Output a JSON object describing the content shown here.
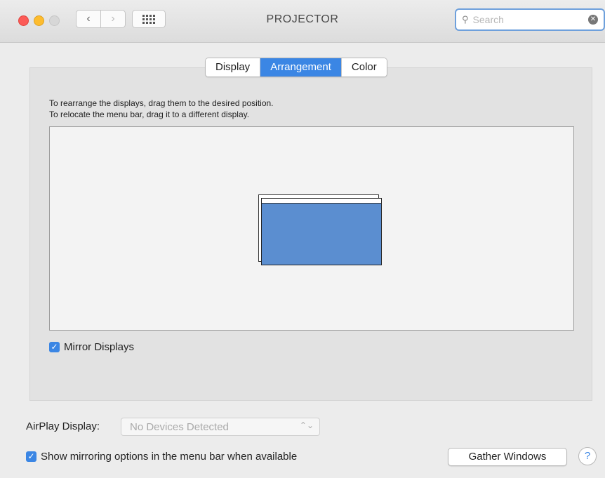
{
  "window": {
    "title": "PROJECTOR",
    "search_placeholder": "Search",
    "search_clear_glyph": "✕"
  },
  "toolbar": {
    "back_glyph": "‹",
    "forward_glyph": "›"
  },
  "tabs": [
    {
      "label": "Display",
      "active": false
    },
    {
      "label": "Arrangement",
      "active": true
    },
    {
      "label": "Color",
      "active": false
    }
  ],
  "arrangement": {
    "instruction_1": "To rearrange the displays, drag them to the desired position.",
    "instruction_2": "To relocate the menu bar, drag it to a different display.",
    "mirror_label": "Mirror Displays",
    "mirror_checked": true
  },
  "airplay": {
    "label": "AirPlay Display:",
    "value": "No Devices Detected",
    "arrows_glyph": "⌃⌄"
  },
  "show_mirroring": {
    "label": "Show mirroring options in the menu bar when available",
    "checked": true
  },
  "buttons": {
    "gather_windows": "Gather Windows",
    "help": "?"
  },
  "check_glyph": "✓",
  "colors": {
    "accent": "#3b86e4",
    "display_fill": "#5b8ed0",
    "close": "#fc5b57",
    "minimize": "#fdbc2e"
  },
  "icons": {
    "close": "close-dot-icon",
    "minimize": "minimize-dot-icon",
    "zoom": "zoom-dot-icon",
    "back": "chevron-left-icon",
    "forward": "chevron-right-icon",
    "show_all": "grid-icon",
    "search": "magnifier-icon",
    "clear": "clear-icon",
    "popup": "updown-arrows-icon",
    "help": "question-icon"
  }
}
